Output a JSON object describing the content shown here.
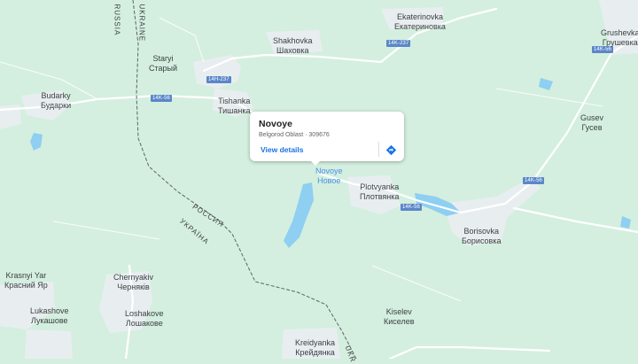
{
  "map": {
    "colors": {
      "land": "#d4efdf",
      "urban": "#e8eef0",
      "road": "#ffffff",
      "water": "#8ecff2",
      "border": "#5f6368",
      "shield": "#5b86c9",
      "accent": "#1a73e8"
    },
    "places": [
      {
        "id": "ekaterinovka",
        "lat": "Ekaterinovka",
        "cyr": "Екатериновка"
      },
      {
        "id": "grushevka",
        "lat": "Grushevka",
        "cyr": "Грушевка"
      },
      {
        "id": "shakhovka",
        "lat": "Shakhovka",
        "cyr": "Шаховка"
      },
      {
        "id": "staryi",
        "lat": "Staryi",
        "cyr": "Старый"
      },
      {
        "id": "budarky",
        "lat": "Budarky",
        "cyr": "Бударки"
      },
      {
        "id": "tishanka",
        "lat": "Tishanka",
        "cyr": "Тишанка"
      },
      {
        "id": "gusev",
        "lat": "Gusev",
        "cyr": "Гусев"
      },
      {
        "id": "novoye",
        "lat": "Novoye",
        "cyr": "Новое"
      },
      {
        "id": "plotvyanka",
        "lat": "Plotvyanka",
        "cyr": "Плотвянка"
      },
      {
        "id": "borisovka",
        "lat": "Borisovka",
        "cyr": "Борисовка"
      },
      {
        "id": "krasnyi_yar",
        "lat": "Krasnyi Yar",
        "cyr": "Красний Яр"
      },
      {
        "id": "chernyakiv",
        "lat": "Chernyakiv",
        "cyr": "Черняків"
      },
      {
        "id": "lukashove",
        "lat": "Lukashove",
        "cyr": "Лукашове"
      },
      {
        "id": "loshakove",
        "lat": "Loshakove",
        "cyr": "Лошакове"
      },
      {
        "id": "kiselev",
        "lat": "Kiselev",
        "cyr": "Киселев"
      },
      {
        "id": "kreidyanka",
        "lat": "Kreidyanka",
        "cyr": "Крейдянка"
      }
    ],
    "road_shields": [
      "14K-237",
      "14H-237",
      "14K-56",
      "14K-56",
      "14K-56",
      "14K-56"
    ],
    "border_labels": {
      "russia_top": "RUSSIA",
      "ukraine_top": "UKRAINE",
      "russia_mid": "РОССИЯ",
      "ukraine_mid": "УКРАЇНА",
      "bottom": "UKR"
    }
  },
  "info_card": {
    "title": "Novoye",
    "subtitle": "Belgorod Oblast · 309676",
    "view_details_label": "View details",
    "directions_icon": "directions-icon"
  }
}
